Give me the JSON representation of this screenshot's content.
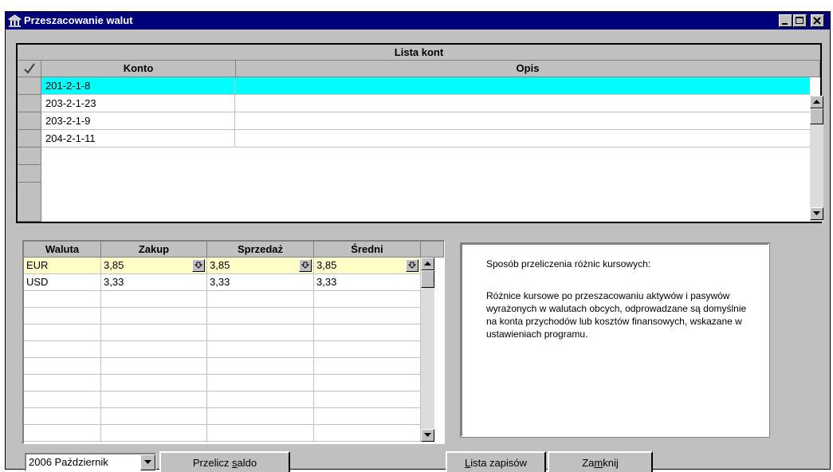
{
  "window": {
    "title": "Przeszacowanie walut",
    "icon": "bank-icon"
  },
  "accounts": {
    "caption": "Lista kont",
    "columns": {
      "check": "check-icon",
      "konto": "Konto",
      "opis": "Opis"
    },
    "rows": [
      {
        "konto": "201-2-1-8",
        "opis": ""
      },
      {
        "konto": "203-2-1-23",
        "opis": ""
      },
      {
        "konto": "203-2-1-9",
        "opis": ""
      },
      {
        "konto": "204-2-1-11",
        "opis": ""
      }
    ],
    "selected_index": 0,
    "selected_color": "#00ffff"
  },
  "currencies": {
    "columns": {
      "waluta": "Waluta",
      "zakup": "Zakup",
      "sprzedaz": "Sprzedaż",
      "sredni": "Średni"
    },
    "rows": [
      {
        "waluta": "EUR",
        "zakup": "3,85",
        "sprzedaz": "3,85",
        "sredni": "3,85"
      },
      {
        "waluta": "USD",
        "zakup": "3,33",
        "sprzedaz": "3,33",
        "sredni": "3,33"
      }
    ],
    "highlight_color": "#ffffc8"
  },
  "info": {
    "line1": "Sposób przeliczenia różnic kursowych:",
    "line2": "Różnice kursowe po przeszacowaniu aktywów i pasywów wyrażonych w walutach obcych, odprowadzane są domyślnie na konta przychodów lub kosztów finansowych, wskazane w ustawieniach programu."
  },
  "controls": {
    "period": "2006 Październik",
    "recalc": {
      "pre": "Przelicz ",
      "key": "s",
      "post": "aldo"
    },
    "entries": {
      "pre": "",
      "key": "L",
      "post": "ista zapisów"
    },
    "close": {
      "pre": "Za",
      "key": "m",
      "post": "knij"
    }
  },
  "colors": {
    "titlebar": "#00007b",
    "face": "#c0c0c0"
  }
}
